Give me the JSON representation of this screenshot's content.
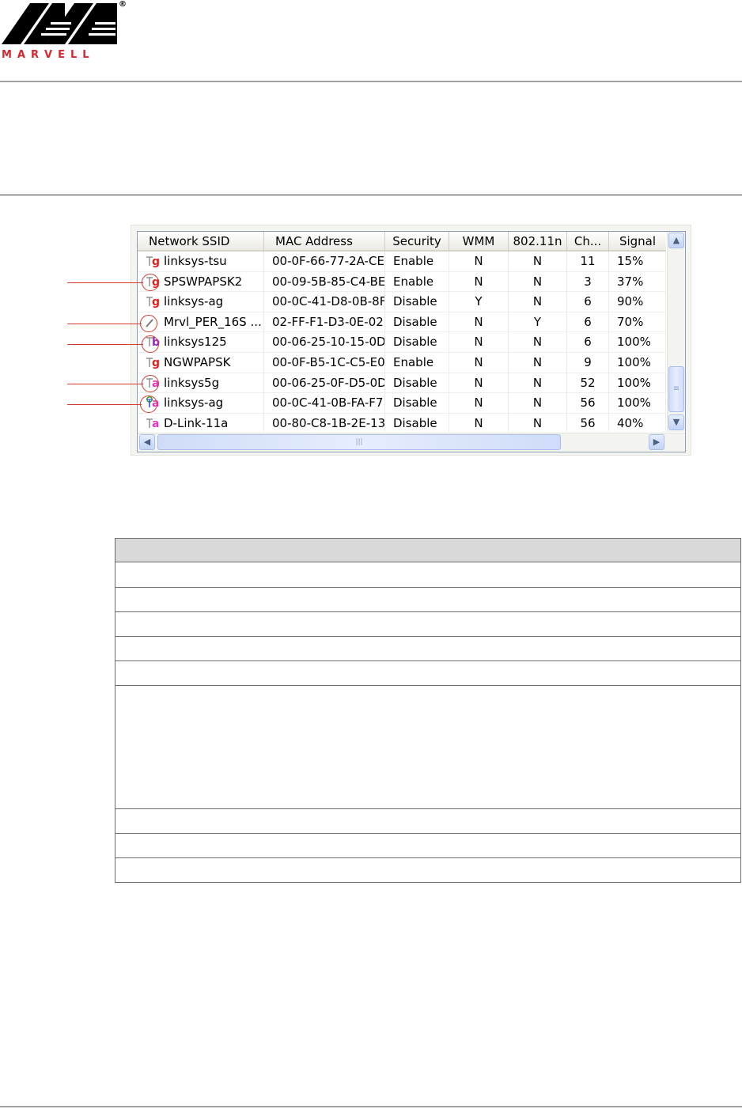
{
  "logo": {
    "word": "MARVELL",
    "registered": "®"
  },
  "figure": {
    "columns": [
      "Network SSID",
      "MAC Address",
      "Security",
      "WMM",
      "802.11n",
      "Ch...",
      "Signal"
    ],
    "rows": [
      {
        "icon": "antenna-icon",
        "band": "g",
        "band_color": "#e0201d",
        "ssid": "linksys-tsu",
        "mac": "00-0F-66-77-2A-CE",
        "security": "Enable",
        "wmm": "N",
        "n": "N",
        "ch": "11",
        "signal": "15%"
      },
      {
        "icon": "antenna-icon",
        "band": "g",
        "band_color": "#e0201d",
        "ssid": "SPSWPAPSK2",
        "mac": "00-09-5B-85-C4-BE",
        "security": "Enable",
        "wmm": "N",
        "n": "N",
        "ch": "3",
        "signal": "37%"
      },
      {
        "icon": "antenna-icon",
        "band": "g",
        "band_color": "#e0201d",
        "ssid": "linksys-ag",
        "mac": "00-0C-41-D8-0B-8F",
        "security": "Disable",
        "wmm": "Y",
        "n": "N",
        "ch": "6",
        "signal": "90%"
      },
      {
        "icon": "adhoc-icon",
        "band": "",
        "band_color": "#e0201d",
        "ssid": "Mrvl_PER_16S ...",
        "mac": "02-FF-F1-D3-0E-02",
        "security": "Disable",
        "wmm": "N",
        "n": "Y",
        "ch": "6",
        "signal": "70%"
      },
      {
        "icon": "antenna-icon",
        "band": "b",
        "band_color": "#a31fd1",
        "ssid": "linksys125",
        "mac": "00-06-25-10-15-0D",
        "security": "Disable",
        "wmm": "N",
        "n": "N",
        "ch": "6",
        "signal": "100%"
      },
      {
        "icon": "antenna-icon",
        "band": "g",
        "band_color": "#e0201d",
        "ssid": "NGWPAPSK",
        "mac": "00-0F-B5-1C-C5-E0",
        "security": "Enable",
        "wmm": "N",
        "n": "N",
        "ch": "9",
        "signal": "100%"
      },
      {
        "icon": "antenna-icon",
        "band": "a",
        "band_color": "#e234c8",
        "ssid": "linksys5g",
        "mac": "00-06-25-0F-D5-0D",
        "security": "Disable",
        "wmm": "N",
        "n": "N",
        "ch": "52",
        "signal": "100%"
      },
      {
        "icon": "connected-antenna-icon",
        "band": "a",
        "band_color": "#e234c8",
        "ssid": "linksys-ag",
        "mac": "00-0C-41-0B-FA-F7",
        "security": "Disable",
        "wmm": "N",
        "n": "N",
        "ch": "56",
        "signal": "100%"
      },
      {
        "icon": "antenna-icon",
        "band": "a",
        "band_color": "#e234c8",
        "ssid": "D-Link-11a",
        "mac": "00-80-C8-1B-2E-13",
        "security": "Disable",
        "wmm": "N",
        "n": "N",
        "ch": "56",
        "signal": "40%"
      }
    ],
    "scroll": {
      "up": "▲",
      "down": "▼",
      "left": "◀",
      "right": "▶",
      "grip": "≡",
      "hgrip": "|||"
    }
  },
  "colors": {
    "callout": "#d23b2a",
    "logo_red": "#d4272e",
    "table_header": "#d9d9d9"
  }
}
